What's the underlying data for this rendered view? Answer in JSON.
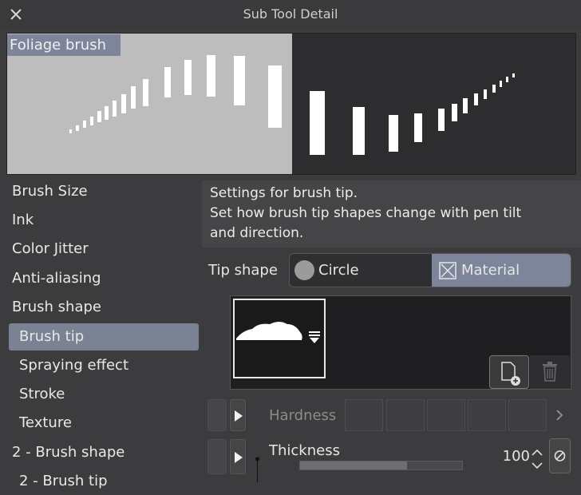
{
  "window": {
    "title": "Sub Tool Detail"
  },
  "preview": {
    "label": "Foliage brush"
  },
  "categories": [
    {
      "label": "Brush Size"
    },
    {
      "label": "Ink"
    },
    {
      "label": "Color Jitter"
    },
    {
      "label": "Anti-aliasing"
    },
    {
      "label": "Brush shape"
    },
    {
      "label": "Brush tip"
    },
    {
      "label": "Spraying effect"
    },
    {
      "label": "Stroke"
    },
    {
      "label": "Texture"
    },
    {
      "label": "2 - Brush shape"
    },
    {
      "label": "2 - Brush tip"
    }
  ],
  "selected_category": "Brush tip",
  "description": {
    "line1": "Settings for brush tip.",
    "line2": "Set how brush tip shapes change with pen tilt",
    "line3": "and direction."
  },
  "tip_shape": {
    "label": "Tip shape",
    "options": [
      {
        "label": "Circle"
      },
      {
        "label": "Material"
      }
    ],
    "selected": "Material"
  },
  "hardness": {
    "label": "Hardness"
  },
  "thickness": {
    "label": "Thickness",
    "value": "100",
    "fraction": 0.66
  },
  "colors": {
    "accent": "#7c8599",
    "background": "#3c3c3e",
    "panel": "#454547"
  },
  "icons": [
    "close-icon",
    "circle-tip-icon",
    "material-tip-icon",
    "tip-menu-icon",
    "add-tip-icon",
    "trash-icon",
    "expand-arrow-icon",
    "chevron-right-icon",
    "spin-up-icon",
    "spin-down-icon",
    "reset-icon"
  ]
}
